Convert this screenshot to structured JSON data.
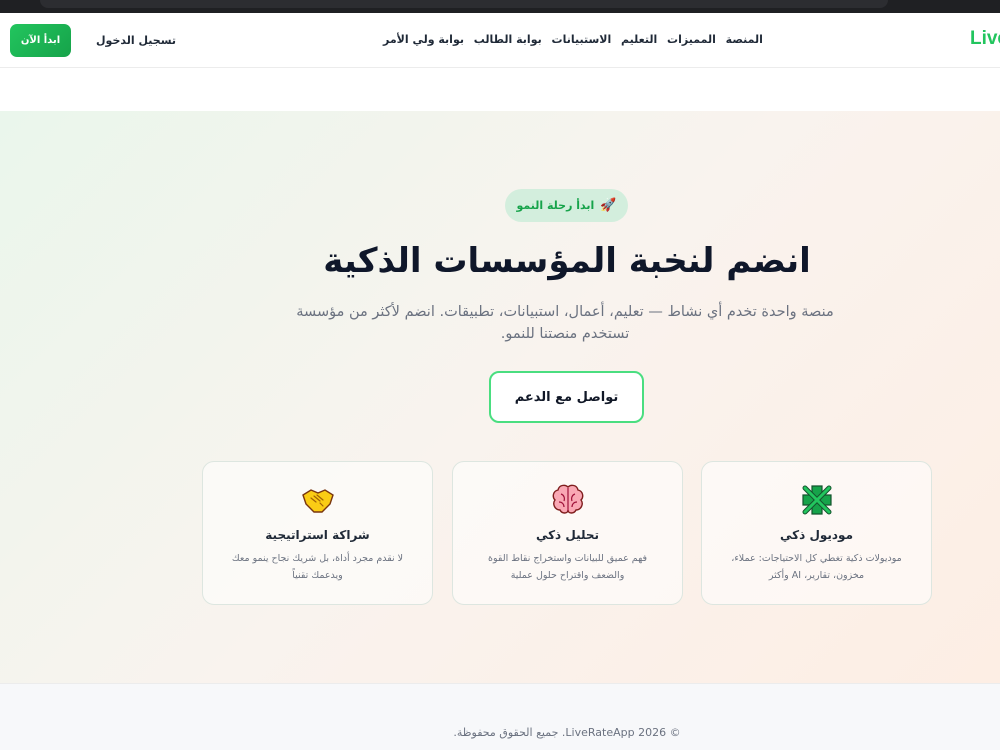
{
  "nav": {
    "logo": "Live",
    "links": [
      "المنصة",
      "المميزات",
      "التعليم",
      "الاستبيانات",
      "بوابة الطالب",
      "بوابة ولي الأمر"
    ],
    "login": "تسجيل الدخول",
    "start": "ابدأ الآن"
  },
  "hero": {
    "badge_text": "ابدأ رحلة النمو",
    "badge_icon": "rocket-icon",
    "title": "انضم لنخبة المؤسسات الذكية",
    "subtitle": "منصة واحدة تخدم أي نشاط — تعليم، أعمال، استبيانات، تطبيقات. انضم لأكثر من مؤسسة تستخدم منصتنا للنمو.",
    "cta": "تواصل مع الدعم"
  },
  "cards": [
    {
      "icon": "puzzle-icon",
      "title": "موديول ذكي",
      "desc": "موديولات ذكية تغطي كل الاحتياجات: عملاء، مخزون، تقارير، AI وأكثر"
    },
    {
      "icon": "brain-icon",
      "title": "تحليل ذكي",
      "desc": "فهم عميق للبيانات واستخراج نقاط القوة والضعف واقتراح حلول عملية"
    },
    {
      "icon": "handshake-icon",
      "title": "شراكة استراتيجية",
      "desc": "لا نقدم مجرد أداة، بل شريك نجاح ينمو معك ويدعمك تقنياً"
    }
  ],
  "footer": {
    "copyright": "© 2026 LiveRateApp. جميع الحقوق محفوظة."
  },
  "colors": {
    "brand": "#22c55e",
    "brand_dark": "#16a34a",
    "badge_bg": "#d3eedd",
    "cta_border": "#4ade80"
  }
}
